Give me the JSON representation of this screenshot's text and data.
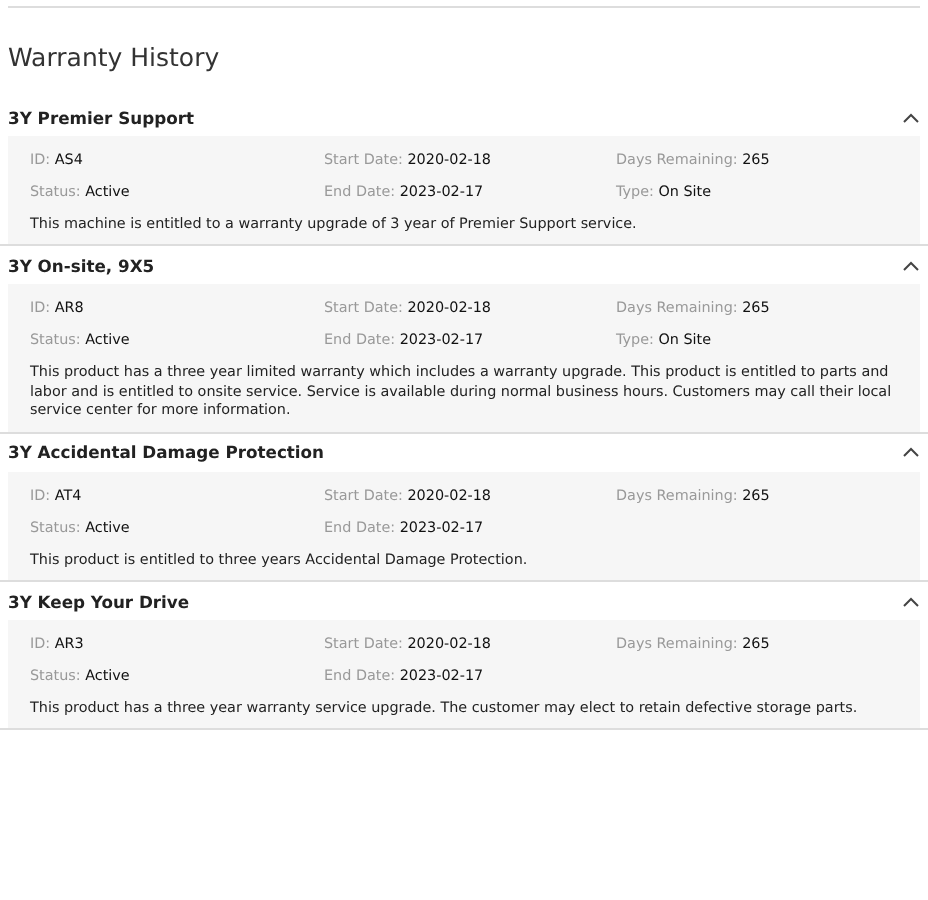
{
  "title": "Warranty History",
  "warranties": [
    {
      "name": "3Y Premier Support",
      "expanded": true,
      "fields": [
        {
          "label": "ID:",
          "value": "AS4"
        },
        {
          "label": "Start Date:",
          "value": "2020-02-18"
        },
        {
          "label": "Days Remaining:",
          "value": "265"
        },
        {
          "label": "Status:",
          "value": "Active"
        },
        {
          "label": "End Date:",
          "value": "2023-02-17"
        },
        {
          "label": "Type:",
          "value": "On Site"
        }
      ],
      "description": "This machine is entitled to a warranty upgrade of 3 year of Premier Support service."
    },
    {
      "name": "3Y On-site, 9X5",
      "expanded": true,
      "fields": [
        {
          "label": "ID:",
          "value": "AR8"
        },
        {
          "label": "Start Date:",
          "value": "2020-02-18"
        },
        {
          "label": "Days Remaining:",
          "value": "265"
        },
        {
          "label": "Status:",
          "value": "Active"
        },
        {
          "label": "End Date:",
          "value": "2023-02-17"
        },
        {
          "label": "Type:",
          "value": "On Site"
        }
      ],
      "description": "This product has a three year limited warranty which includes a warranty upgrade. This product is entitled to parts and labor and is entitled to onsite service. Service is available during normal business hours. Customers may call their local service center for more information."
    },
    {
      "name": "3Y Accidental Damage Protection",
      "expanded": true,
      "fields": [
        {
          "label": "ID:",
          "value": "AT4"
        },
        {
          "label": "Start Date:",
          "value": "2020-02-18"
        },
        {
          "label": "Days Remaining:",
          "value": "265"
        },
        {
          "label": "Status:",
          "value": "Active"
        },
        {
          "label": "End Date:",
          "value": "2023-02-17"
        }
      ],
      "description": "This product is entitled to three years Accidental Damage Protection."
    },
    {
      "name": "3Y Keep Your Drive",
      "expanded": true,
      "fields": [
        {
          "label": "ID:",
          "value": "AR3"
        },
        {
          "label": "Start Date:",
          "value": "2020-02-18"
        },
        {
          "label": "Days Remaining:",
          "value": "265"
        },
        {
          "label": "Status:",
          "value": "Active"
        },
        {
          "label": "End Date:",
          "value": "2023-02-17"
        }
      ],
      "description": "This product has a three year warranty service upgrade. The customer may elect to retain defective storage parts."
    }
  ]
}
